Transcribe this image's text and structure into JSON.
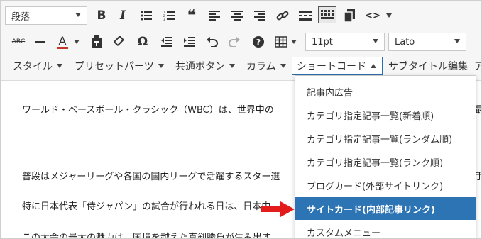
{
  "toolbar": {
    "format_select": "段落",
    "font_size_select": "11pt",
    "font_family_select": "Lato",
    "icons_row1": [
      "bold-icon",
      "italic-icon",
      "bullet-list-icon",
      "numbered-list-icon",
      "blockquote-icon",
      "align-left-icon",
      "align-center-icon",
      "align-right-icon",
      "link-icon",
      "read-more-icon",
      "toolbar-toggle-icon",
      "copy-icon",
      "code-icon"
    ],
    "icons_row2": [
      "strikethrough-icon",
      "horizontal-line-icon",
      "text-color-icon",
      "paste-as-text-icon",
      "clear-formatting-icon",
      "special-character-icon",
      "outdent-icon",
      "indent-icon",
      "undo-icon",
      "redo-icon",
      "help-icon",
      "table-icon"
    ],
    "bold_label": "B",
    "italic_label": "I",
    "abc_label": "ABC",
    "text_color_label": "A",
    "omega_label": "Ω",
    "help_label": "?",
    "code_label": "<>"
  },
  "menus": [
    {
      "label": "スタイル"
    },
    {
      "label": "プリセットパーツ"
    },
    {
      "label": "共通ボタン"
    },
    {
      "label": "カラム"
    },
    {
      "label": "ショートコード",
      "active": true
    },
    {
      "label": "サブタイトル編集"
    },
    {
      "label": "ア"
    }
  ],
  "content": {
    "lines": [
      "ワールド・ベースボール・クラシック（WBC）は、世界中の",
      "普段はメジャーリーグや各国の国内リーグで活躍するスター選",
      "特に日本代表「侍ジャパン」の試合が行われる日は、日本中",
      "この大会の最大の魅力は、国境を越えた真剣勝負が生み出す"
    ],
    "right_edge_chars": [
      "最",
      "手"
    ]
  },
  "dropdown": {
    "items": [
      {
        "label": "記事内広告"
      },
      {
        "label": "カテゴリ指定記事一覧(新着順)"
      },
      {
        "label": "カテゴリ指定記事一覧(ランダム順)"
      },
      {
        "label": "カテゴリ指定記事一覧(ランク順)"
      },
      {
        "label": "ブログカード(外部サイトリンク)"
      },
      {
        "label": "サイトカード(内部記事リンク)",
        "highlighted": true
      },
      {
        "label": "カスタムメニュー"
      }
    ]
  },
  "colors": {
    "highlight": "#2c74b3",
    "arrow": "#e41b1b",
    "active_border": "#2a6fb3"
  }
}
